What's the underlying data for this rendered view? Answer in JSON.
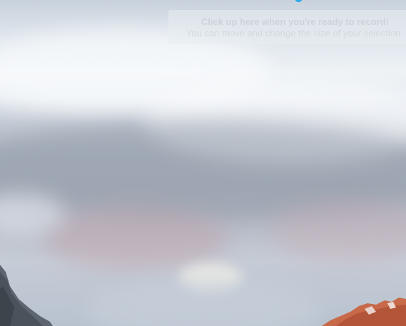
{
  "window": {
    "title": ""
  },
  "recorder": {
    "hint_title": "Click up here when you're ready to record!",
    "hint_subtitle": "You can move and change the size of your selection",
    "indicator_color": "#2ea8e8"
  },
  "desktop": {
    "wallpaper": "cloudy-sky-with-mountains"
  }
}
